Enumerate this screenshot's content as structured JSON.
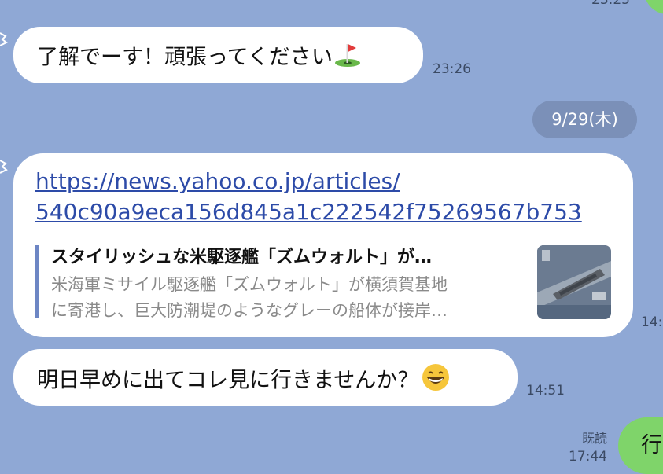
{
  "messages": {
    "top_time_fragment": "23:25",
    "m1": {
      "text": "了解でーす！頑張ってください",
      "time": "23:26",
      "emoji": "golf-flag"
    },
    "date_separator": "9/29(木)",
    "m2": {
      "link_line1": "https://news.yahoo.co.jp/articles/",
      "link_line2": "540c90a9eca156d845a1c222542f75269567b753",
      "preview_title": "スタイリッシュな米駆逐艦「ズムウォルト」が…",
      "preview_desc_line1": "米海軍ミサイル駆逐艦「ズムウォルト」が横須賀基地",
      "preview_desc_line2": "に寄港し、巨大防潮堤のようなグレーの船体が接岸…",
      "time_fragment": "14:"
    },
    "m3": {
      "text": "明日早めに出てコレ見に行きませんか？",
      "time": "14:51",
      "emoji": "grinning-face"
    },
    "m4": {
      "read_label": "既読",
      "time": "17:44",
      "text_fragment": "行"
    }
  },
  "colors": {
    "background": "#8fa8d5",
    "incoming_bubble": "#ffffff",
    "outgoing_bubble": "#7fd46a",
    "link": "#2d4ba8"
  }
}
